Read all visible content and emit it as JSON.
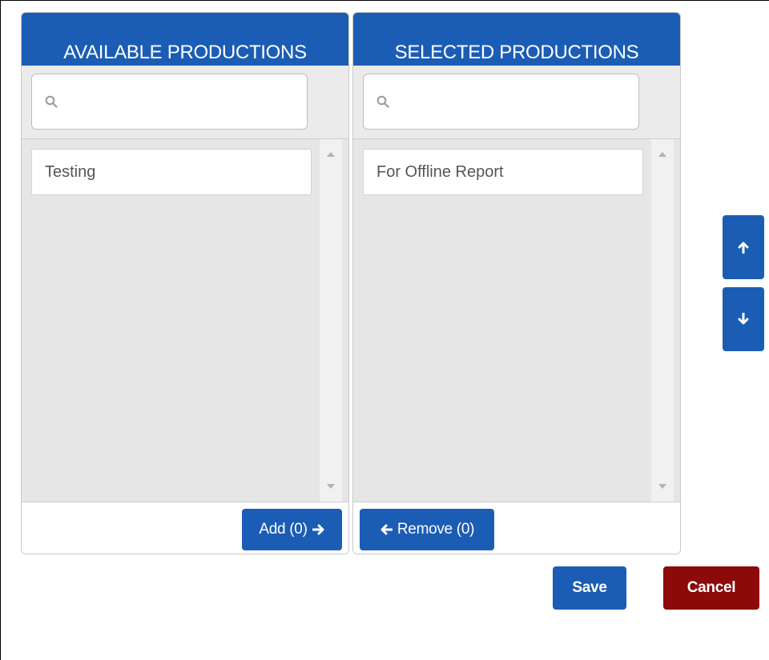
{
  "available": {
    "header": "AVAILABLE PRODUCTIONS",
    "search_value": "",
    "search_placeholder": "",
    "items": [
      {
        "label": "Testing"
      }
    ],
    "add_label": "Add (0)"
  },
  "selected": {
    "header": "SELECTED PRODUCTIONS",
    "search_value": "",
    "search_placeholder": "",
    "items": [
      {
        "label": "For Offline Report"
      }
    ],
    "remove_label": "Remove (0)"
  },
  "reorder": {
    "up_icon": "arrow-up-icon",
    "down_icon": "arrow-down-icon"
  },
  "actions": {
    "save_label": "Save",
    "cancel_label": "Cancel"
  },
  "colors": {
    "accent": "#1b5db4",
    "cancel": "#8c0a0a",
    "list_background": "#e6e6e6"
  }
}
